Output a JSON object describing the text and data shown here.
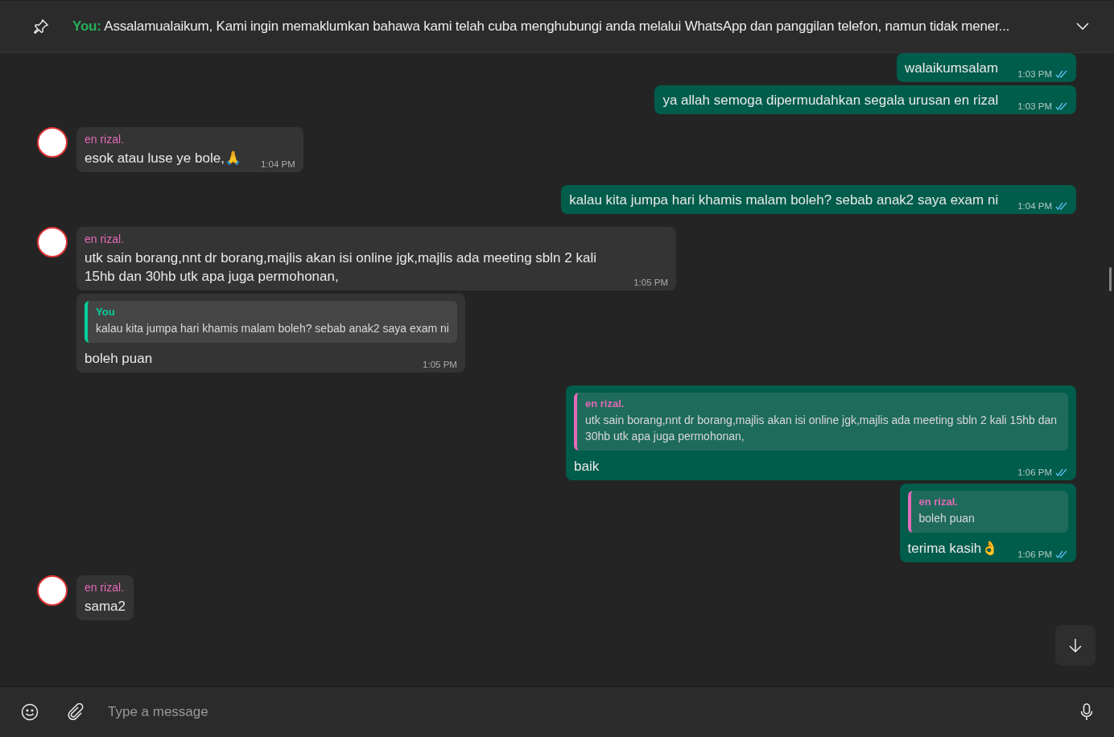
{
  "pinned": {
    "author": "You:",
    "text": "Assalamualaikum,  Kami ingin memaklumkan bahawa kami telah cuba menghubungi anda melalui WhatsApp dan panggilan telefon, namun tidak mener..."
  },
  "messages": [
    {
      "kind": "out",
      "text": "walaikumsalam",
      "time": "1:03 PM",
      "read": true
    },
    {
      "kind": "out",
      "text": "ya allah semoga dipermudahkan segala urusan en rizal",
      "time": "1:03 PM",
      "read": true
    },
    {
      "kind": "in",
      "author": "en rizal.",
      "avatar": true,
      "text": "esok atau luse ye bole,🙏",
      "time": "1:04 PM"
    },
    {
      "kind": "out",
      "text": "kalau kita jumpa hari khamis malam boleh? sebab anak2 saya exam ni",
      "time": "1:04 PM",
      "read": true
    },
    {
      "kind": "in",
      "author": "en rizal.",
      "avatar": true,
      "text": "utk sain borang,nnt dr borang,majlis akan isi online jgk,majlis ada meeting sbln 2 kali 15hb dan 30hb utk apa juga permohonan,",
      "time": "1:05 PM"
    },
    {
      "kind": "in",
      "avatar": false,
      "quote": {
        "author": "You",
        "color": "#06cf9c",
        "text": "kalau kita jumpa hari khamis malam boleh? sebab anak2 saya exam ni"
      },
      "text": "boleh puan",
      "time": "1:05 PM"
    },
    {
      "kind": "out",
      "quote": {
        "author": "en rizal.",
        "color": "#e26ab6",
        "text": "utk sain borang,nnt dr borang,majlis akan isi online jgk,majlis ada meeting sbln 2 kali 15hb dan 30hb utk apa juga permohonan,"
      },
      "text": "baik",
      "time": "1:06 PM",
      "read": true
    },
    {
      "kind": "out",
      "quote": {
        "author": "en rizal.",
        "color": "#e26ab6",
        "text": "boleh puan"
      },
      "text": "terima kasih👌",
      "time": "1:06 PM",
      "read": true
    },
    {
      "kind": "in",
      "author": "en rizal.",
      "avatar": true,
      "text": "sama2"
    }
  ],
  "composer": {
    "placeholder": "Type a message"
  }
}
